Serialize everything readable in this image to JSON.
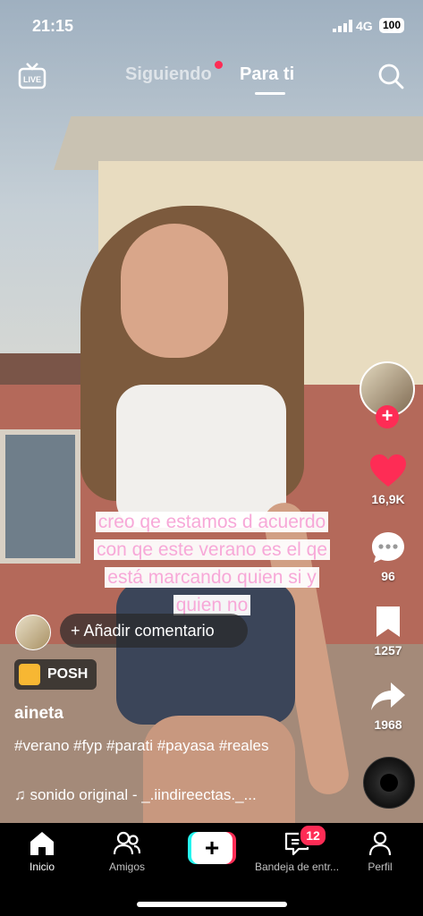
{
  "status_bar": {
    "time": "21:15",
    "network": "4G",
    "battery": "100"
  },
  "top_nav": {
    "tab_following": "Siguiendo",
    "tab_for_you": "Para ti"
  },
  "video": {
    "overlay_caption": [
      "creo qe estamos d acuerdo",
      "con qe este verano es el qe",
      "está marcando quien si y",
      "quien no"
    ]
  },
  "side_actions": {
    "likes": "16,9K",
    "comments": "96",
    "saves": "1257",
    "shares": "1968"
  },
  "post": {
    "comment_prompt": "+ Añadir comentario",
    "effect_label": "POSH",
    "username": "aineta",
    "description": "#verano #fyp #parati #payasa #reales",
    "sound": "♫ sonido original - _.iindireectas._..."
  },
  "bottom_nav": {
    "home": "Inicio",
    "friends": "Amigos",
    "inbox": "Bandeja de entr...",
    "inbox_badge": "12",
    "profile": "Perfil"
  },
  "colors": {
    "accent": "#fe2c55",
    "cyan": "#25f4ee",
    "caption_pink": "#f7a8d8"
  }
}
